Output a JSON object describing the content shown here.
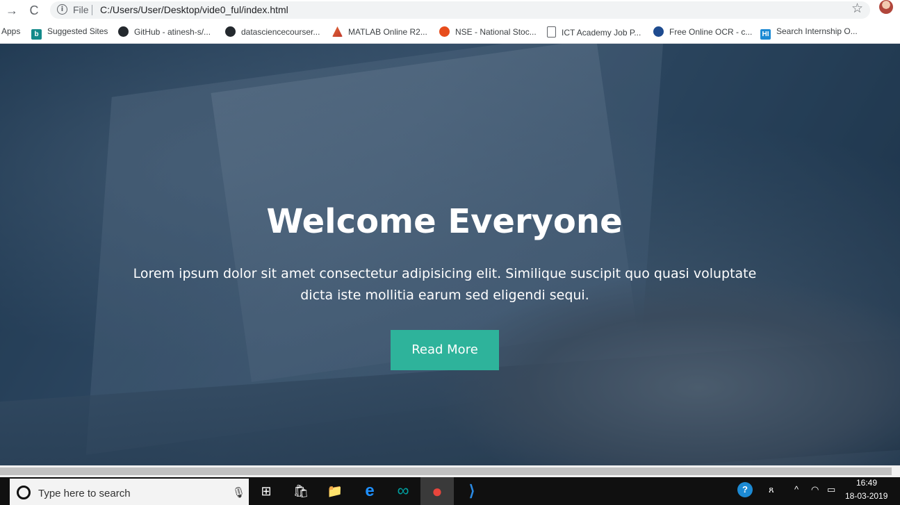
{
  "browser": {
    "back_icon": "→",
    "reload_icon": "C",
    "info_glyph": "i",
    "file_label": "File",
    "url": "C:/Users/User/Desktop/vide0_ful/index.html",
    "star_icon": "☆"
  },
  "bookmarks": [
    {
      "label": "Apps",
      "icon": "apps-icon",
      "glyph": ""
    },
    {
      "label": "Suggested Sites",
      "icon": "bing-icon",
      "glyph": "b"
    },
    {
      "label": "GitHub - atinesh-s/...",
      "icon": "github-icon",
      "glyph": "●"
    },
    {
      "label": "datasciencecourser...",
      "icon": "github-icon",
      "glyph": "●"
    },
    {
      "label": "MATLAB Online R2...",
      "icon": "matlab-icon",
      "glyph": ""
    },
    {
      "label": "NSE - National Stoc...",
      "icon": "nse-icon",
      "glyph": ""
    },
    {
      "label": "ICT Academy Job P...",
      "icon": "document-icon",
      "glyph": ""
    },
    {
      "label": "Free Online OCR - c...",
      "icon": "ocr-icon",
      "glyph": ""
    },
    {
      "label": "Search Internship O...",
      "icon": "hi-icon",
      "glyph": "HI"
    }
  ],
  "hero": {
    "title": "Welcome Everyone",
    "text": "Lorem ipsum dolor sit amet consectetur adipisicing elit. Similique suscipit quo quasi voluptate dicta iste mollitia earum sed eligendi sequi.",
    "button_label": "Read More",
    "button_color": "#2eb39b"
  },
  "taskbar": {
    "search_placeholder": "Type here to search",
    "mic_icon": "🎙",
    "apps": [
      {
        "name": "task-view-icon",
        "glyph": "⊞"
      },
      {
        "name": "store-icon",
        "glyph": "🛍"
      },
      {
        "name": "file-explorer-icon",
        "glyph": "📁"
      },
      {
        "name": "edge-icon",
        "glyph": "e"
      },
      {
        "name": "arduino-icon",
        "glyph": "∞"
      },
      {
        "name": "chrome-icon",
        "glyph": "●"
      },
      {
        "name": "vscode-icon",
        "glyph": "⟩"
      }
    ],
    "tray": {
      "help_icon": "?",
      "people_icon": "ጸ",
      "chevron_icon": "^",
      "wifi_icon": "◠",
      "battery_icon": "▭"
    },
    "time": "16:49",
    "date": "18-03-2019"
  }
}
